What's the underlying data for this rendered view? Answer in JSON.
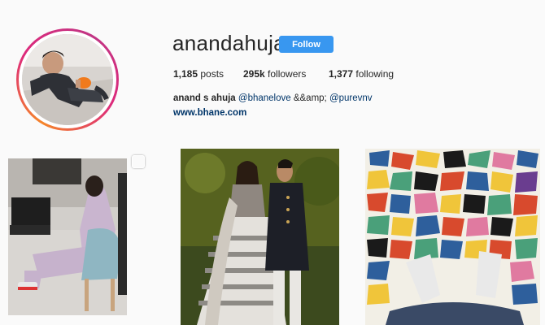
{
  "profile": {
    "username": "anandahuja",
    "follow_label": "Follow",
    "stats": {
      "posts_count": "1,185",
      "posts_label": " posts",
      "followers_count": "295k",
      "followers_label": " followers",
      "following_count": "1,377",
      "following_label": " following"
    },
    "bio": {
      "full_name": "anand s ahuja",
      "mention_1": "@bhanelove",
      "separator": " &&amp; ",
      "mention_2": "@purevnv"
    },
    "website": "www.bhane.com"
  },
  "icons": {
    "multi_post": "multiple-photos-icon"
  },
  "colors": {
    "follow_button": "#3897f0",
    "link": "#003569",
    "story_ring": [
      "#f58529",
      "#dd2a7b",
      "#c13584"
    ]
  }
}
